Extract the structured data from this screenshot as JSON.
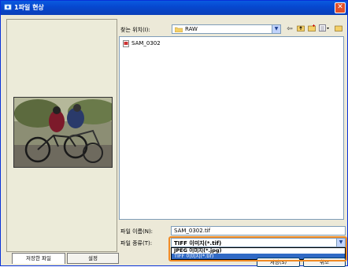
{
  "window": {
    "title": "1파일 현상"
  },
  "left": {
    "tabs": [
      {
        "label": "저장한 파일"
      },
      {
        "label": "설정"
      }
    ]
  },
  "lookin": {
    "label": "찾는 위치(I):",
    "value": "RAW"
  },
  "files": [
    {
      "name": "SAM_0302"
    }
  ],
  "filename": {
    "label": "파일 이름(N):",
    "value": "SAM_0302.tif"
  },
  "filetype": {
    "label": "파일 종류(T):",
    "selected": "TIFF 이미지(*.tif)",
    "options": [
      "JPEG 이미지(*.jpg)",
      "TIFF 이미지(*.tif)"
    ]
  },
  "buttons": {
    "save": "저장(S)",
    "cancel": "취소"
  },
  "colors": {
    "title_bar": "#0a5be0",
    "selection": "#316ac5",
    "highlight": "#f08a24"
  },
  "icons": [
    "app-icon",
    "close-icon",
    "folder-icon",
    "back-icon",
    "up-folder-icon",
    "new-folder-icon",
    "view-menu-icon",
    "file-icon"
  ]
}
